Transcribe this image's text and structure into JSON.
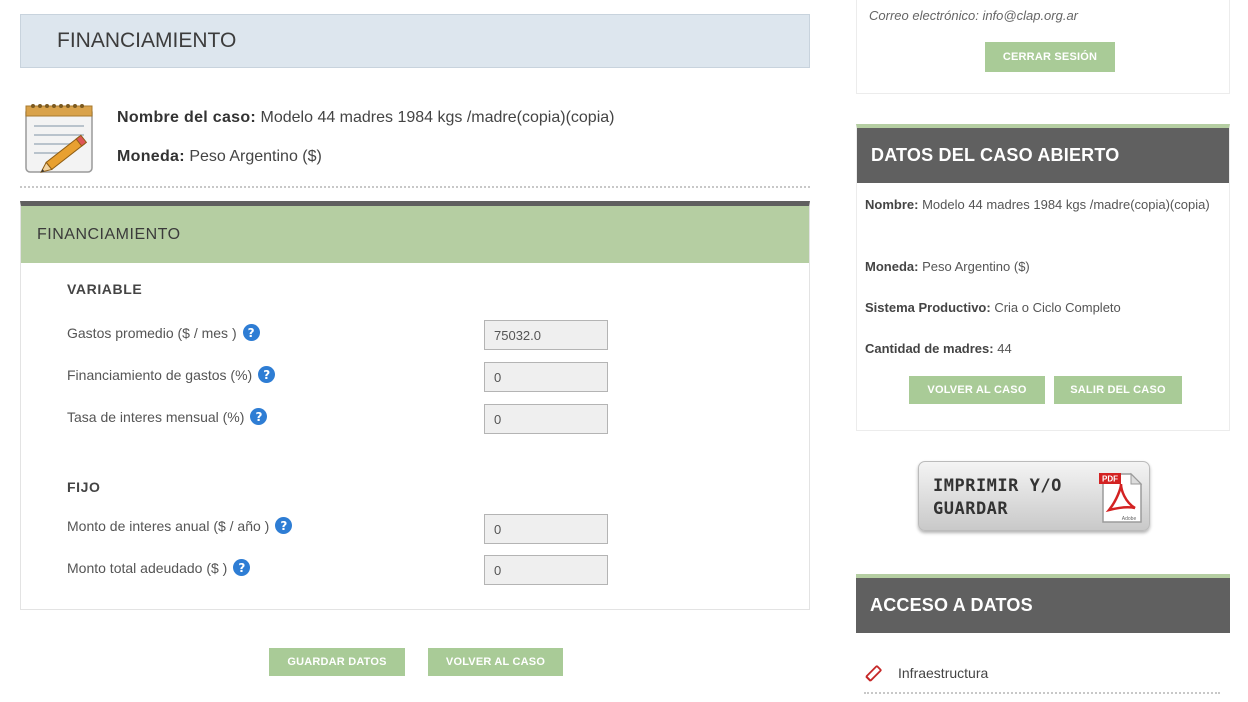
{
  "header": {
    "title": "FINANCIAMIENTO"
  },
  "case": {
    "name_label": "Nombre del caso:",
    "name_value": "Modelo 44 madres  1984 kgs /madre(copia)(copia)",
    "currency_label": "Moneda:",
    "currency_value": "Peso Argentino ($)"
  },
  "form": {
    "panel_title": "FINANCIAMIENTO",
    "variable": {
      "title": "VARIABLE",
      "fields": [
        {
          "label": "Gastos promedio ($ / mes )",
          "value": "75032.0"
        },
        {
          "label": "Financiamiento de gastos (%)",
          "value": "0"
        },
        {
          "label": "Tasa de interes mensual (%)",
          "value": "0"
        }
      ]
    },
    "fijo": {
      "title": "FIJO",
      "fields": [
        {
          "label": "Monto de interes anual ($ / año )",
          "value": "0"
        },
        {
          "label": "Monto total adeudado ($ )",
          "value": "0"
        }
      ]
    },
    "help_glyph": "?"
  },
  "buttons": {
    "save": "GUARDAR DATOS",
    "back": "VOLVER AL CASO"
  },
  "session": {
    "email": "Correo electrónico: info@clap.org.ar",
    "logout": "CERRAR SESIÓN"
  },
  "open_case": {
    "title": "DATOS DEL CASO ABIERTO",
    "name_label": "Nombre:",
    "name_value": "Modelo 44 madres 1984 kgs /madre(copia)(copia)",
    "currency_label": "Moneda:",
    "currency_value": "Peso Argentino ($)",
    "system_label": "Sistema Productivo:",
    "system_value": "Cria o Ciclo Completo",
    "mothers_label": "Cantidad de madres:",
    "mothers_value": "44",
    "back_button": "VOLVER AL CASO",
    "exit_button": "SALIR DEL CASO"
  },
  "print": {
    "line1": "IMPRIMIR Y/O",
    "line2": "GUARDAR",
    "pdf_badge": "PDF",
    "adobe": "Adobe"
  },
  "access": {
    "title": "ACCESO A DATOS",
    "items": [
      {
        "label": "Infraestructura",
        "icon": "pencil-icon"
      }
    ]
  },
  "colors": {
    "green": "#b5cea2",
    "button_green": "#a9cb97",
    "dark_head": "#606060",
    "header_blue": "#dde6ee",
    "help_blue": "#2e7dd4"
  }
}
